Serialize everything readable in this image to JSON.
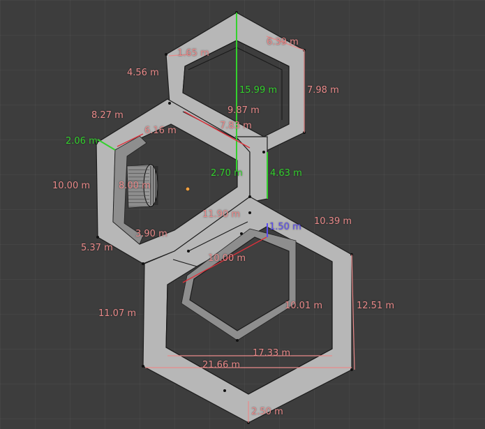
{
  "colors": {
    "background": "#3d3d3d",
    "mesh_face": "#b7b7b7",
    "measure_red": "#e98a8a",
    "measure_green": "#34d12e",
    "measure_blue": "#5a4cf0",
    "origin": "#f0a040"
  },
  "measurements": [
    {
      "text": "1.65 m",
      "color": "#e98a8a"
    },
    {
      "text": "6.39 m",
      "color": "#e98a8a"
    },
    {
      "text": "4.56 m",
      "color": "#e98a8a"
    },
    {
      "text": "15.99 m",
      "color": "#34d12e"
    },
    {
      "text": "7.98 m",
      "color": "#e98a8a"
    },
    {
      "text": "9.87 m",
      "color": "#e98a8a"
    },
    {
      "text": "8.27 m",
      "color": "#e98a8a"
    },
    {
      "text": "7.83 m",
      "color": "#e98a8a"
    },
    {
      "text": "6.16 m",
      "color": "#e98a8a"
    },
    {
      "text": "2.06 m",
      "color": "#34d12e"
    },
    {
      "text": "2.70 m",
      "color": "#34d12e"
    },
    {
      "text": "4.63 m",
      "color": "#34d12e"
    },
    {
      "text": "10.00 m",
      "color": "#e98a8a"
    },
    {
      "text": "8.00 m",
      "color": "#e98a8a"
    },
    {
      "text": "11.90 m",
      "color": "#e98a8a"
    },
    {
      "text": "10.39 m",
      "color": "#e98a8a"
    },
    {
      "text": "1.50 m",
      "color": "#5a4cf0"
    },
    {
      "text": "3.90 m",
      "color": "#e98a8a"
    },
    {
      "text": "5.37 m",
      "color": "#e98a8a"
    },
    {
      "text": "10.00 m",
      "color": "#e98a8a"
    },
    {
      "text": "11.07 m",
      "color": "#e98a8a"
    },
    {
      "text": "10.01 m",
      "color": "#e98a8a"
    },
    {
      "text": "12.51 m",
      "color": "#e98a8a"
    },
    {
      "text": "17.33 m",
      "color": "#e98a8a"
    },
    {
      "text": "21.66 m",
      "color": "#e98a8a"
    },
    {
      "text": "2.50 m",
      "color": "#e98a8a"
    }
  ]
}
